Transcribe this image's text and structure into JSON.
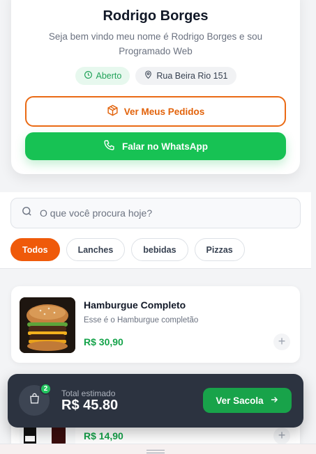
{
  "store": {
    "name": "Rodrigo Borges",
    "description": "Seja bem vindo meu nome é Rodrigo Borges e sou Programado Web",
    "status": "Aberto",
    "address": "Rua Beira Rio 151"
  },
  "actions": {
    "orders_label": "Ver Meus Pedidos",
    "whatsapp_label": "Falar no WhatsApp"
  },
  "search": {
    "placeholder": "O que você procura hoje?",
    "value": ""
  },
  "categories": [
    {
      "label": "Todos",
      "active": true
    },
    {
      "label": "Lanches",
      "active": false
    },
    {
      "label": "bebidas",
      "active": false
    },
    {
      "label": "Pizzas",
      "active": false
    }
  ],
  "products": [
    {
      "name": "Hamburgue Completo",
      "description": "Esse é o Hamburgue completão",
      "price": "R$ 30,90",
      "add_label": "+"
    },
    {
      "name": "",
      "description": "",
      "price": "R$ 14,90",
      "add_label": "+"
    }
  ],
  "cart": {
    "count": "2",
    "label": "Total estimado",
    "total": "R$ 45.80",
    "button_label": "Ver Sacola"
  },
  "colors": {
    "brand_orange": "#ef5a0a",
    "whatsapp_green": "#17c254",
    "price_green": "#15a34a",
    "cart_dark": "#2c3340"
  },
  "icons": {
    "status": "clock-icon",
    "address": "map-pin-icon",
    "orders": "package-icon",
    "whatsapp": "phone-icon",
    "search": "search-icon",
    "cart": "shopping-bag-icon",
    "cart_button": "arrow-right-icon",
    "handle": "drag-handle-icon"
  }
}
